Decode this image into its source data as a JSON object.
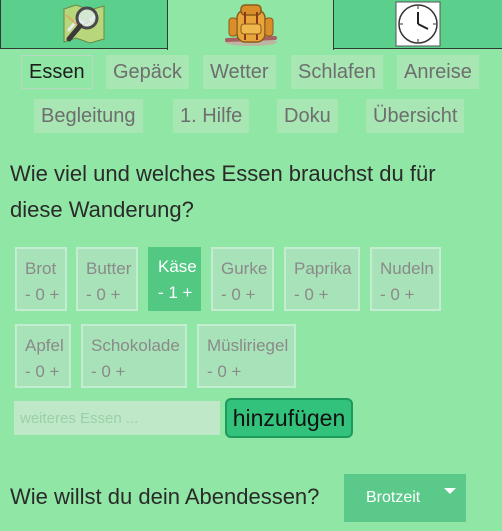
{
  "top_tabs": [
    {
      "icon": "map-magnifier-icon",
      "active": false
    },
    {
      "icon": "backpack-icon",
      "active": true
    },
    {
      "icon": "clock-icon",
      "active": false
    }
  ],
  "nav": {
    "row1": [
      "Essen",
      "Gepäck",
      "Wetter",
      "Schlafen",
      "Anreise"
    ],
    "row2": [
      "Begleitung",
      "1. Hilfe",
      "Doku",
      "Übersicht"
    ],
    "active": "Essen"
  },
  "question": "Wie viel und welches Essen brauchst du für diese Wanderung?",
  "foods": [
    {
      "name": "Brot",
      "count": "- 0 +",
      "selected": false
    },
    {
      "name": "Butter",
      "count": "- 0 +",
      "selected": false
    },
    {
      "name": "Käse",
      "count": "- 1 +",
      "selected": true
    },
    {
      "name": "Gurke",
      "count": "- 0 +",
      "selected": false
    },
    {
      "name": "Paprika",
      "count": "- 0 +",
      "selected": false
    },
    {
      "name": "Nudeln",
      "count": "- 0 +",
      "selected": false
    },
    {
      "name": "Apfel",
      "count": "- 0 +",
      "selected": false
    },
    {
      "name": "Schokolade",
      "count": "- 0 +",
      "selected": false
    },
    {
      "name": "Müsliriegel",
      "count": "- 0 +",
      "selected": false
    }
  ],
  "add_food": {
    "placeholder": "weiteres Essen ...",
    "value": "",
    "button_label": "hinzufügen"
  },
  "dinner": {
    "question": "Wie willst du dein Abendessen?",
    "selected": "Brotzeit"
  },
  "colors": {
    "background": "#90e6a4",
    "tab": "#5ad08c",
    "selected": "#52c882",
    "button": "#32c27c"
  }
}
